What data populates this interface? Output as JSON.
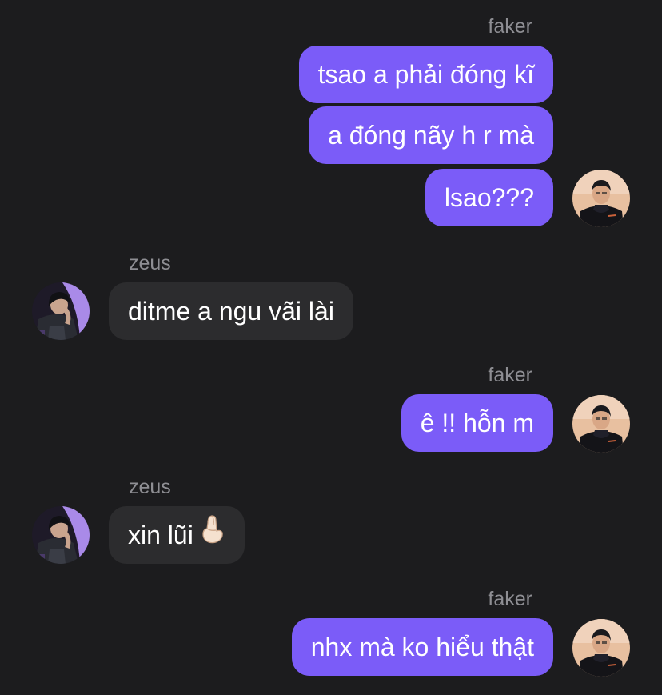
{
  "colors": {
    "background": "#1c1c1e",
    "outgoing_bubble": "#7b5cf8",
    "incoming_bubble": "#2c2c2e",
    "sender_name": "#8e8e93",
    "message_text": "#ffffff"
  },
  "messages": [
    {
      "sender": "faker",
      "text": "tsao a phải đóng kĩ"
    },
    {
      "text": "a đóng nãy h r mà"
    },
    {
      "text": "lsao???"
    },
    {
      "sender": "zeus",
      "text": "ditme a ngu vãi lài"
    },
    {
      "sender": "faker",
      "text": "ê !! hỗn m"
    },
    {
      "sender": "zeus",
      "text": "xin lũi",
      "emoji": "pinched-fingers-emoji"
    },
    {
      "sender": "faker",
      "text": "nhx mà ko hiểu thật"
    }
  ]
}
